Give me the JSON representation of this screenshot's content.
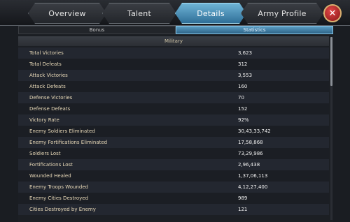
{
  "tabs": [
    {
      "label": "Overview",
      "active": false
    },
    {
      "label": "Talent",
      "active": false
    },
    {
      "label": "Details",
      "active": true
    },
    {
      "label": "Army Profile",
      "active": false
    }
  ],
  "close_icon": "close-icon",
  "subtabs": [
    {
      "label": "Bonus",
      "active": false
    },
    {
      "label": "Statistics",
      "active": true
    }
  ],
  "section": {
    "title": "Military"
  },
  "stats": [
    {
      "label": "Total Victories",
      "value": "3,623"
    },
    {
      "label": "Total Defeats",
      "value": "312"
    },
    {
      "label": "Attack Victories",
      "value": "3,553"
    },
    {
      "label": "Attack Defeats",
      "value": "160"
    },
    {
      "label": "Defense Victories",
      "value": "70"
    },
    {
      "label": "Defense Defeats",
      "value": "152"
    },
    {
      "label": "Victory Rate",
      "value": "92%"
    },
    {
      "label": "Enemy Soldiers Eliminated",
      "value": "30,43,33,742"
    },
    {
      "label": "Enemy Fortifications Eliminated",
      "value": "17,58,868"
    },
    {
      "label": "Soldiers Lost",
      "value": "73,29,986"
    },
    {
      "label": "Fortifications Lost",
      "value": "2,96,438"
    },
    {
      "label": "Wounded Healed",
      "value": "1,37,06,113"
    },
    {
      "label": "Enemy Troops Wounded",
      "value": "4,12,27,400"
    },
    {
      "label": "Enemy Cities Destroyed",
      "value": "989"
    },
    {
      "label": "Cities Destroyed by Enemy",
      "value": "121"
    }
  ],
  "colors": {
    "active_tab": "#4a95bf",
    "stat_label": "#e8d9b8",
    "close_button": "#c02828"
  }
}
